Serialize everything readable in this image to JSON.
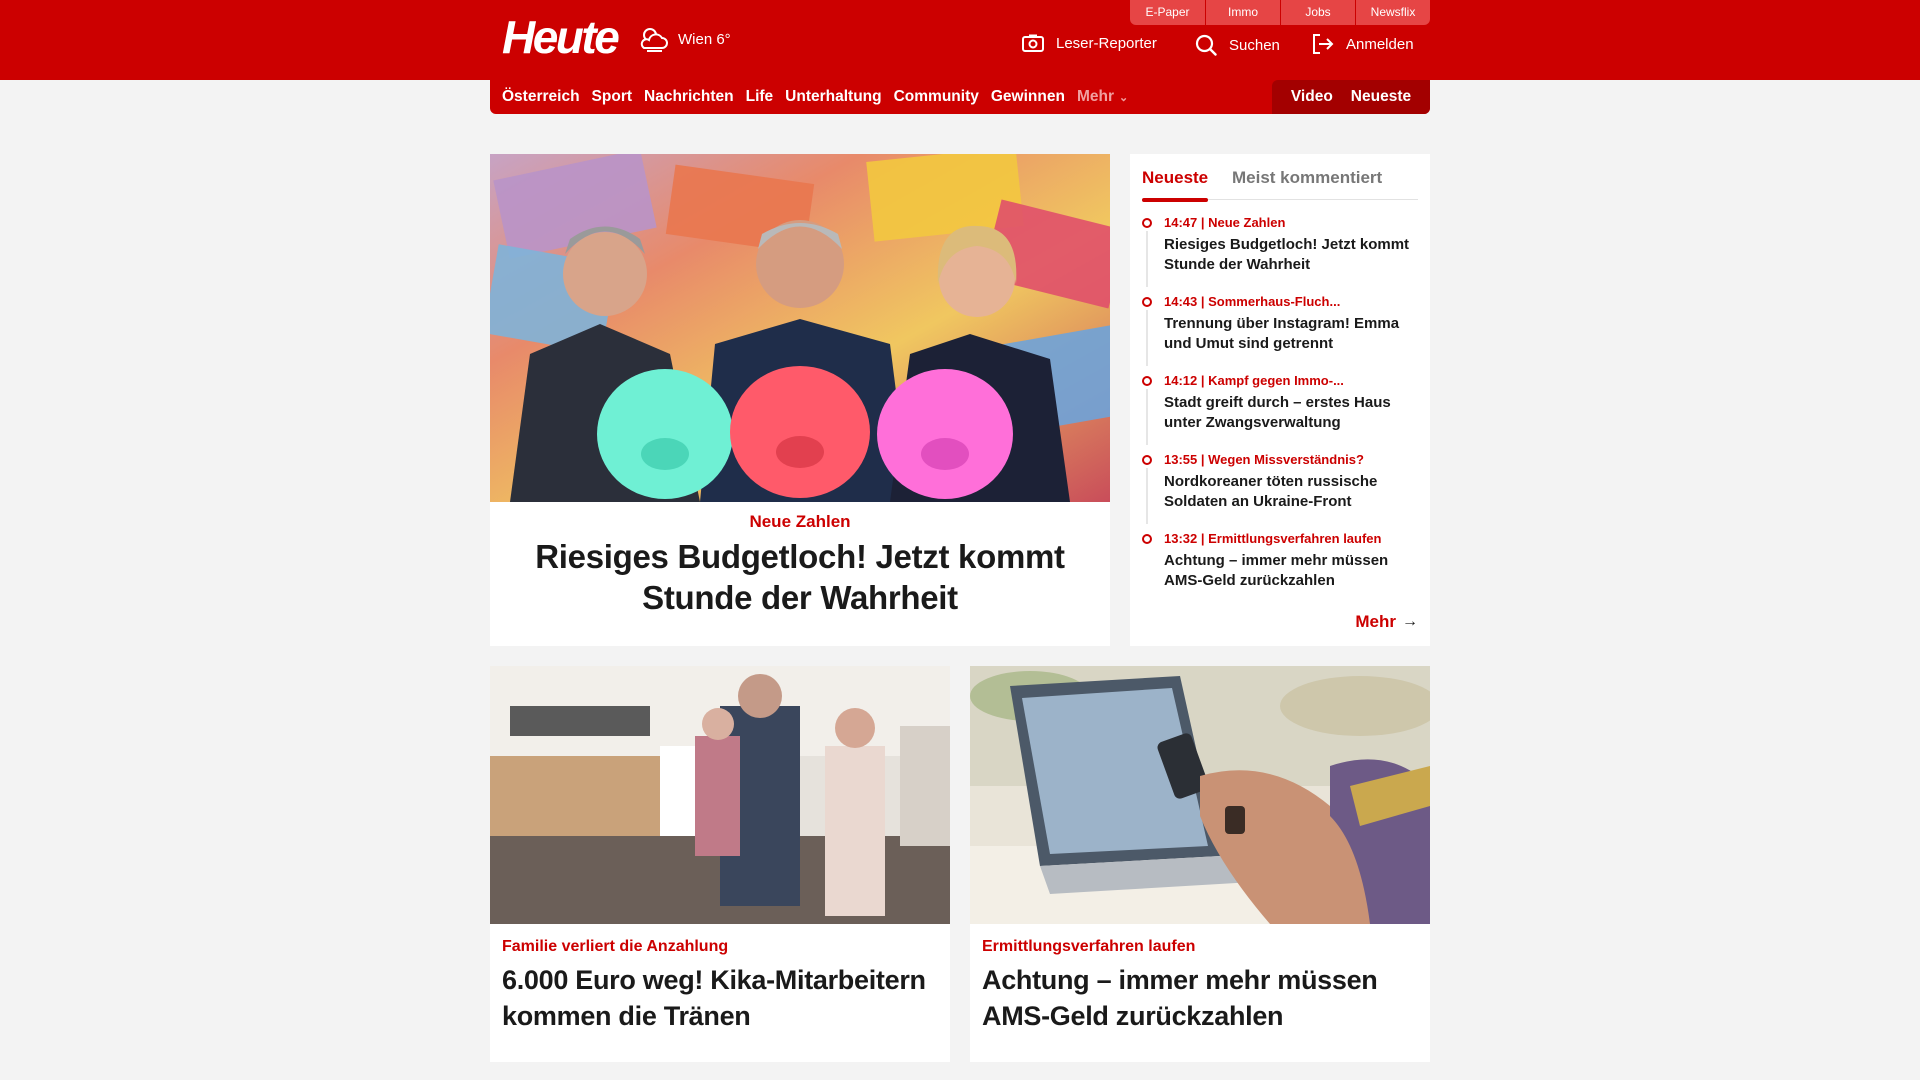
{
  "header": {
    "logo": "Heute",
    "weather": "Wien 6°",
    "service_links": [
      "E-Paper",
      "Immo",
      "Jobs",
      "Newsflix"
    ],
    "actions": {
      "reporter": "Leser-Reporter",
      "search": "Suchen",
      "login": "Anmelden"
    }
  },
  "nav": {
    "items": [
      "Österreich",
      "Sport",
      "Nachrichten",
      "Life",
      "Unterhaltung",
      "Community",
      "Gewinnen"
    ],
    "more": "Mehr",
    "video": "Video",
    "latest": "Neueste"
  },
  "hero": {
    "kicker": "Neue Zahlen",
    "title": "Riesiges Budgetloch! Jetzt kommt Stunde der Wahrheit"
  },
  "sidebar": {
    "tab_active": "Neueste",
    "tab_inactive": "Meist kommentiert",
    "items": [
      {
        "meta": "14:47 | Neue Zahlen",
        "title": "Riesiges Budgetloch! Jetzt kommt Stunde der Wahrheit"
      },
      {
        "meta": "14:43 | Sommerhaus-Fluch...",
        "title": "Trennung über Instagram! Emma und Umut sind getrennt"
      },
      {
        "meta": "14:12 | Kampf gegen Immo-...",
        "title": "Stadt greift durch – erstes Haus unter Zwangsverwaltung"
      },
      {
        "meta": "13:55 | Wegen Missverständnis?",
        "title": "Nordkoreaner töten russische Soldaten an Ukraine-Front"
      },
      {
        "meta": "13:32 | Ermittlungsverfahren laufen",
        "title": "Achtung – immer mehr müssen AMS-Geld zurückzahlen"
      }
    ],
    "more": "Mehr"
  },
  "cards": [
    {
      "kicker": "Familie verliert die Anzahlung",
      "title": "6.000 Euro weg! Kika-Mitarbeitern kommen die Tränen"
    },
    {
      "kicker": "Ermittlungsverfahren laufen",
      "title": "Achtung – immer mehr müssen AMS-Geld zurückzahlen"
    }
  ],
  "colors": {
    "brand_red": "#cc0000",
    "dark_red": "#a30000",
    "background": "#f3f3f3"
  },
  "icons": [
    "weather-cloud-icon",
    "camera-icon",
    "search-icon",
    "login-icon",
    "chevron-down-icon",
    "arrow-right-icon"
  ]
}
